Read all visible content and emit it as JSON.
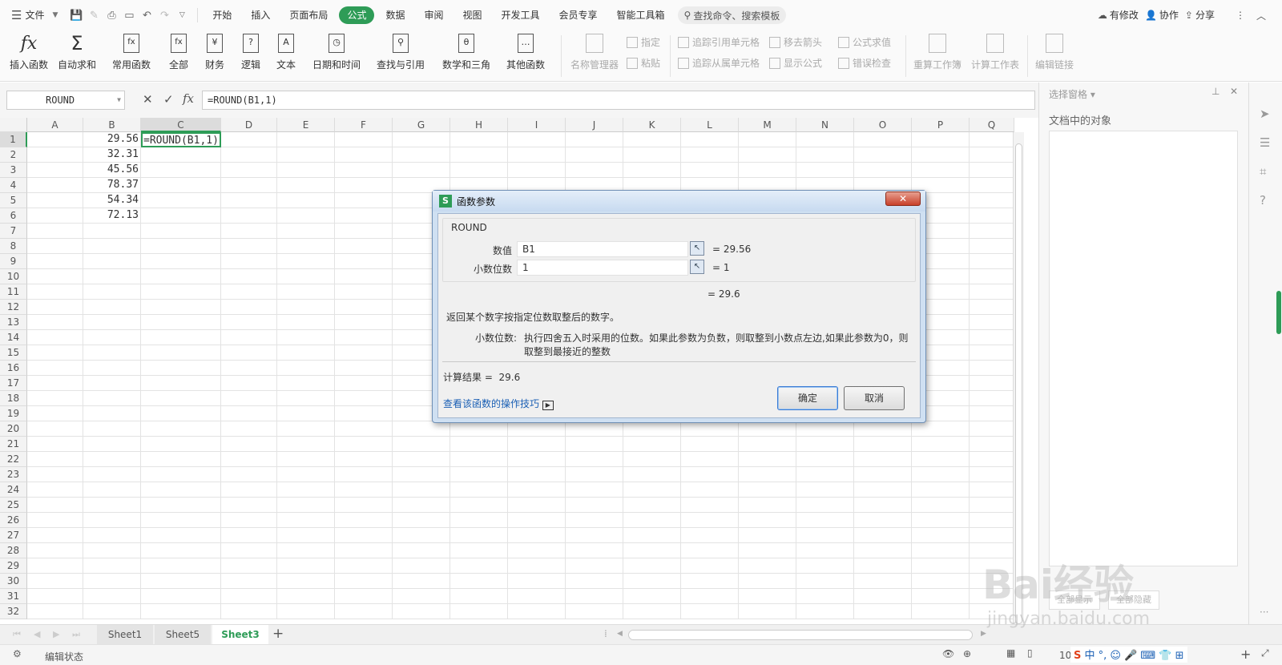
{
  "menu": {
    "file": "文件",
    "items": [
      "开始",
      "插入",
      "页面布局",
      "公式",
      "数据",
      "审阅",
      "视图",
      "开发工具",
      "会员专享",
      "智能工具箱"
    ],
    "active_index": 3,
    "search": "查找命令、搜索模板",
    "modified": "有修改",
    "collab": "协作",
    "share": "分享"
  },
  "ribbon": {
    "big": [
      "插入函数",
      "自动求和",
      "常用函数",
      "全部",
      "财务",
      "逻辑",
      "文本",
      "日期和时间",
      "查找与引用",
      "数学和三角",
      "其他函数",
      "名称管理器"
    ],
    "specify": "指定",
    "paste": "粘贴",
    "trace_precedents": "追踪引用单元格",
    "trace_dependents": "追踪从属单元格",
    "remove_arrows": "移去箭头",
    "show_formulas": "显示公式",
    "evaluate": "公式求值",
    "error_check": "错误检查",
    "recalc_wb": "重算工作簿",
    "calc_ws": "计算工作表",
    "edit_links": "编辑链接"
  },
  "namebox": "ROUND",
  "formula": "=ROUND(B1,1)",
  "columns": [
    "A",
    "B",
    "C",
    "D",
    "E",
    "F",
    "G",
    "H",
    "I",
    "J",
    "K",
    "L",
    "M",
    "N",
    "O",
    "P",
    "Q"
  ],
  "rows": [
    "1",
    "2",
    "3",
    "4",
    "5",
    "6",
    "7",
    "8",
    "9",
    "10",
    "11",
    "12",
    "13",
    "14",
    "15",
    "16",
    "17",
    "18",
    "19",
    "20",
    "21",
    "22",
    "23",
    "24",
    "25",
    "26",
    "27",
    "28",
    "29",
    "30",
    "31",
    "32"
  ],
  "b_values": [
    "29.56",
    "32.31",
    "45.56",
    "78.37",
    "54.34",
    "72.13"
  ],
  "c1": "=ROUND(B1,1)",
  "pane": {
    "title": "选择窗格",
    "subtitle": "文档中的对象",
    "show_all": "全部显示",
    "hide_all": "全部隐藏"
  },
  "sheets": [
    "Sheet1",
    "Sheet5",
    "Sheet3"
  ],
  "active_sheet": "Sheet3",
  "status": {
    "mode": "编辑状态",
    "zoom": "10"
  },
  "dialog": {
    "title": "函数参数",
    "func": "ROUND",
    "arg1_label": "数值",
    "arg1_value": "B1",
    "arg1_result": "= 29.56",
    "arg2_label": "小数位数",
    "arg2_value": "1",
    "arg2_result": "= 1",
    "result_eq": "= 29.6",
    "desc": "返回某个数字按指定位数取整后的数字。",
    "param_name": "小数位数:",
    "param_desc_line1": "执行四舍五入时采用的位数。如果此参数为负数，则取整到小数点左边,如果此参数为0，则",
    "param_desc_line2": "取整到最接近的整数",
    "calc_result": "计算结果 =  29.6",
    "help_link": "查看该函数的操作技巧",
    "ok": "确定",
    "cancel": "取消"
  },
  "watermark": {
    "text": "Bai经验",
    "url": "jingyan.baidu.com"
  },
  "colors": {
    "accent": "#2e9c57",
    "link": "#1a5fb4"
  }
}
